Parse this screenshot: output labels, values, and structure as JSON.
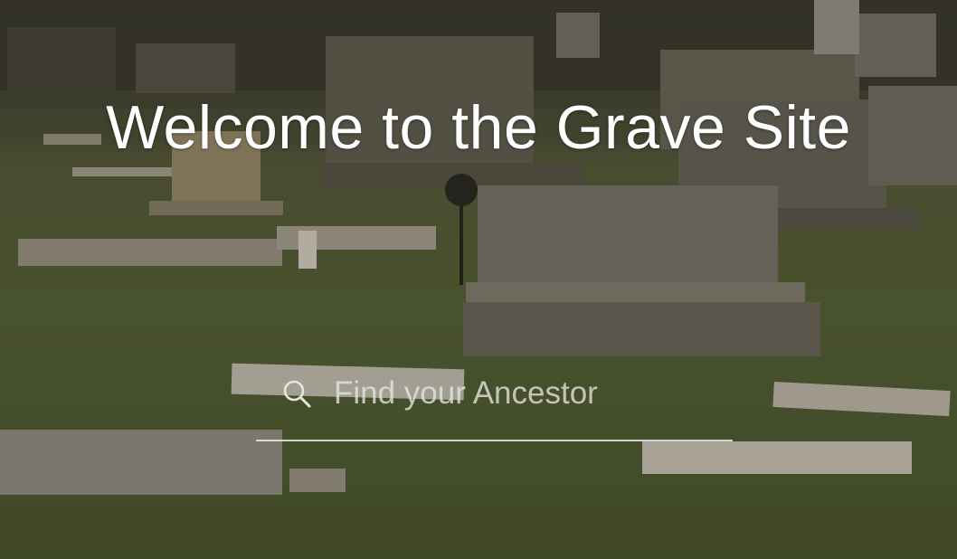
{
  "hero": {
    "title": "Welcome to the Grave Site"
  },
  "search": {
    "placeholder": "Find your Ancestor",
    "icon": "search-icon",
    "value": ""
  },
  "background": {
    "scene": "cemetery",
    "colors": {
      "grass": "#4a5a32",
      "stone": "#7a786c",
      "title_text": "#ffffff"
    }
  }
}
